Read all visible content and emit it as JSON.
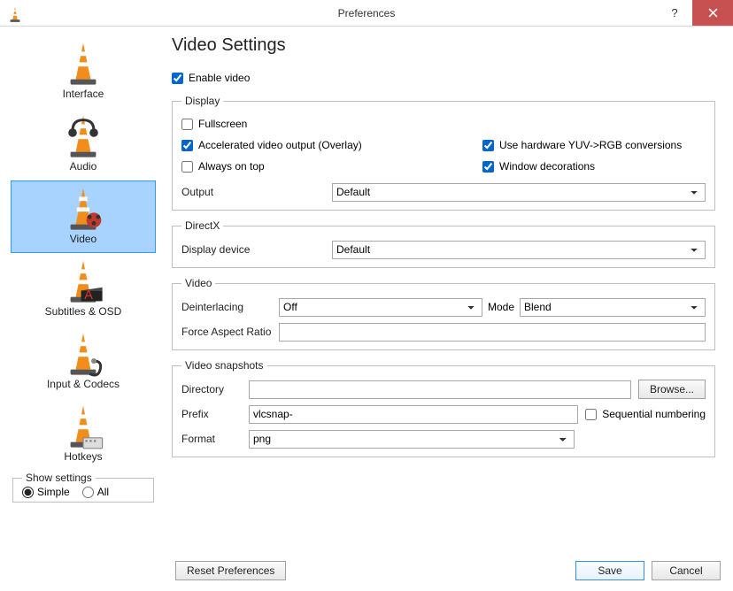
{
  "window": {
    "title": "Preferences"
  },
  "sidebar": {
    "items": [
      {
        "label": "Interface"
      },
      {
        "label": "Audio"
      },
      {
        "label": "Video"
      },
      {
        "label": "Subtitles & OSD"
      },
      {
        "label": "Input & Codecs"
      },
      {
        "label": "Hotkeys"
      }
    ],
    "show_settings": {
      "title": "Show settings",
      "simple": "Simple",
      "all": "All"
    }
  },
  "page": {
    "title": "Video Settings",
    "enable_video": "Enable video",
    "display": {
      "legend": "Display",
      "fullscreen": "Fullscreen",
      "accel": "Accelerated video output (Overlay)",
      "always_on_top": "Always on top",
      "hw_yuv": "Use hardware YUV->RGB conversions",
      "window_dec": "Window decorations",
      "output_label": "Output",
      "output_value": "Default"
    },
    "directx": {
      "legend": "DirectX",
      "device_label": "Display device",
      "device_value": "Default"
    },
    "video": {
      "legend": "Video",
      "deint_label": "Deinterlacing",
      "deint_value": "Off",
      "mode_label": "Mode",
      "mode_value": "Blend",
      "ratio_label": "Force Aspect Ratio",
      "ratio_value": ""
    },
    "snapshots": {
      "legend": "Video snapshots",
      "dir_label": "Directory",
      "dir_value": "",
      "browse": "Browse...",
      "prefix_label": "Prefix",
      "prefix_value": "vlcsnap-",
      "seq_label": "Sequential numbering",
      "format_label": "Format",
      "format_value": "png"
    }
  },
  "buttons": {
    "reset": "Reset Preferences",
    "save": "Save",
    "cancel": "Cancel"
  }
}
